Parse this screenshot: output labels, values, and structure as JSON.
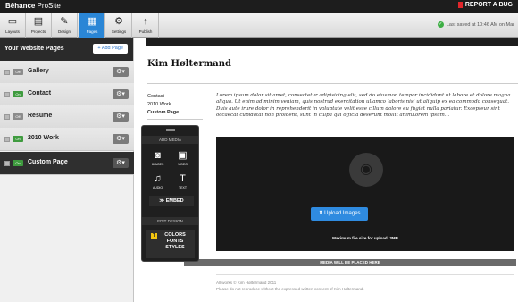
{
  "topbar": {
    "brand_bold": "Bēhance",
    "brand_light": " ProSite",
    "report_bug": "REPORT A BUG"
  },
  "toolbar": {
    "tools": [
      {
        "label": "Layouts",
        "icon": "layouts-icon",
        "glyph": "▭"
      },
      {
        "label": "Projects",
        "icon": "projects-icon",
        "glyph": "▤"
      },
      {
        "label": "Design",
        "icon": "design-icon",
        "glyph": "✎"
      },
      {
        "label": "Pages",
        "icon": "pages-icon",
        "glyph": "▦"
      },
      {
        "label": "Settings",
        "icon": "gear-icon",
        "glyph": "⚙"
      },
      {
        "label": "Publish",
        "icon": "publish-arrow-icon",
        "glyph": "↑"
      }
    ],
    "active_tool": "Pages",
    "saved_text": "Last saved at 10:46 AM on Mar"
  },
  "sidebar": {
    "title": "Your Website Pages",
    "add_page": "+ Add Page",
    "pages": [
      {
        "name": "Gallery",
        "status": "Off"
      },
      {
        "name": "Contact",
        "status": "On"
      },
      {
        "name": "Resume",
        "status": "Off"
      },
      {
        "name": "2010 Work",
        "status": "On"
      },
      {
        "name": "Custom Page",
        "status": "On"
      }
    ],
    "current_page": "Custom Page"
  },
  "site": {
    "title": "Kim Høltermand",
    "nav": [
      "Contact",
      "2010 Work",
      "Custom Page"
    ],
    "body": "Lorem ipsum dolor sit amet, consectetur adipisicing elit, sed do eiusmod tempor incididunt ut labore et dolore magna aliqua. Ut enim ad minim veniam, quis nostrud exercitation ullamco laboris nisi ut aliquip ex ea commodo consequat. Duis aute irure dolor in reprehenderit in voluptate velit esse cillum dolore eu fugiat nulla pariatur. Excepteur sint occaecat cupidatat non proident, sunt in culpa qui officia deserunt mollit animLorem ipsum...",
    "upload_button": "Upload Images",
    "max_file": "Maximum file size for upload: 3MB",
    "placed_label": "MEDIA WILL BE PLACED HERE",
    "footer_line1": "All works © Kim Høltermand 2011",
    "footer_line2": "Please do not reproduce without the expressed written consent of Kim Høltermand."
  },
  "panel": {
    "add_media": "ADD MEDIA",
    "tiles": [
      {
        "label": "IMAGES",
        "icon": "camera-icon",
        "glyph": "📷"
      },
      {
        "label": "VIDEO",
        "icon": "video-icon",
        "glyph": "🎞"
      },
      {
        "label": "AUDIO",
        "icon": "music-icon",
        "glyph": "♫"
      },
      {
        "label": "TEXT",
        "icon": "text-icon",
        "glyph": "T"
      }
    ],
    "embed": "≫ EMBED",
    "edit_design": "EDIT DESIGN",
    "design_lines": "COLORS FONTS STYLES",
    "design_badge": "T"
  },
  "colors": {
    "accent": "#2a86d6",
    "on_toggle": "#3f9b3f",
    "bug": "#e0262b"
  }
}
